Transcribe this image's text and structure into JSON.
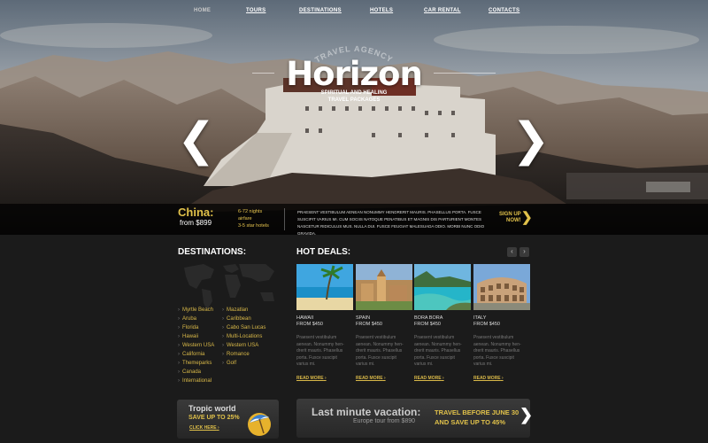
{
  "nav": {
    "items": [
      {
        "label": "HOME",
        "active": true
      },
      {
        "label": "TOURS"
      },
      {
        "label": "DESTINATIONS"
      },
      {
        "label": "HOTELS"
      },
      {
        "label": "CAR RENTAL"
      },
      {
        "label": "CONTACTS"
      }
    ]
  },
  "hero": {
    "agency": "TRAVEL AGENCY",
    "logo": "Horizon",
    "tagline": "SPIRITUAL AND HEALING\nTRAVEL PACKAGES",
    "prev_icon": "chevron-left-icon",
    "next_icon": "chevron-right-icon"
  },
  "feature": {
    "name": "China:",
    "price": "from $899",
    "meta_1": "6-72 nights",
    "meta_2": "airfare",
    "meta_3": "3-5 star hotels",
    "description": "Praesent vestibulum aenean nonummy hendrerit mauris. Phasellus porta. Fusce suscipit varius mi. Cum sociis natoque penatibus et magnis dis parturient montes nascetur ridiculus mus. Nulla dui. Fusce feugiat malesuada odio. Morbi nunc odio gravida.",
    "signup_line1": "SIGN UP",
    "signup_line2": "NOW!"
  },
  "destinations": {
    "title": "DESTINATIONS:",
    "col1": [
      "Myrtle Beach",
      "Aruba",
      "Florida",
      "Hawaii",
      "Western USA",
      "California",
      "Themeparks",
      "Canada",
      "International"
    ],
    "col2": [
      "Mazatlan",
      "Caribbean",
      "Cabo San Lucas",
      "Multi-Locations",
      "Western USA",
      "Romance",
      "Golf"
    ]
  },
  "deals": {
    "title": "HOT DEALS:",
    "items": [
      {
        "name": "HAWAII",
        "price": "FROM $450",
        "text": "Praesent vestibulum aenean. Nonummy hen-drerit mauris. Phasellus porta. Fusce suscipit varius mi.",
        "more": "READ MORE"
      },
      {
        "name": "SPAIN",
        "price": "FROM $450",
        "text": "Praesent vestibulum aenean. Nonummy hen-drerit mauris. Phasellus porta. Fusce suscipit varius mi.",
        "more": "READ MORE"
      },
      {
        "name": "BORA BORA",
        "price": "FROM $450",
        "text": "Praesent vestibulum aenean. Nonummy hen-drerit mauris. Phasellus porta. Fusce suscipit varius mi.",
        "more": "READ MORE"
      },
      {
        "name": "ITALY",
        "price": "FROM $450",
        "text": "Praesent vestibulum aenean. Nonummy hen-drerit mauris. Phasellus porta. Fusce suscipit varius mi.",
        "more": "READ MORE"
      }
    ]
  },
  "promo": {
    "title": "Tropic world",
    "subtitle": "SAVE UP TO 25%",
    "link": "CLICK HERE"
  },
  "lastminute": {
    "title": "Last minute vacation:",
    "subtitle": "Europe tour from $890",
    "offer": "TRAVEL BEFORE JUNE 30\nAND SAVE UP TO 45%"
  },
  "colors": {
    "accent": "#e0c14a",
    "background": "#1b1b1b"
  }
}
